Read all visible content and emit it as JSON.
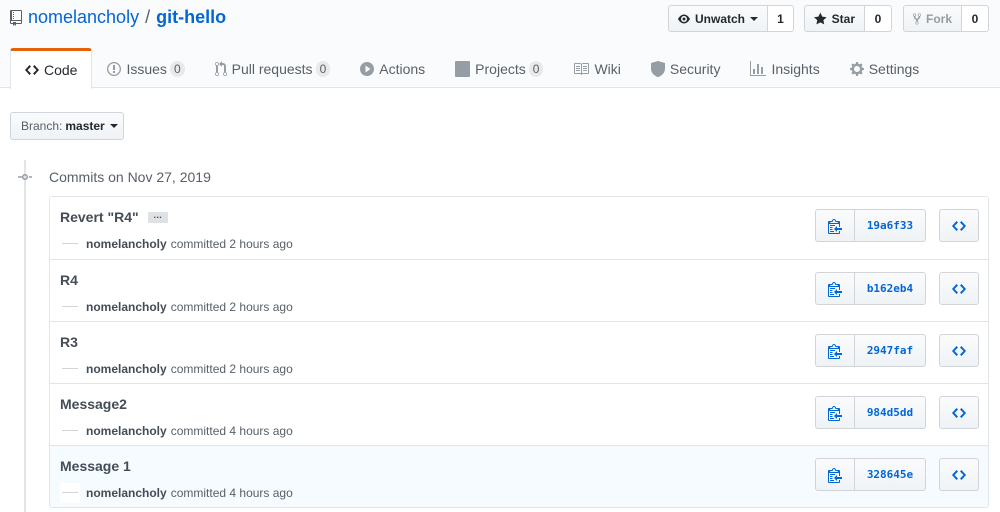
{
  "repo": {
    "owner": "nomelancholy",
    "separator": "/",
    "name": "git-hello"
  },
  "header_actions": [
    {
      "label": "Unwatch",
      "count": "1",
      "icon": "eye-icon"
    },
    {
      "label": "Star",
      "count": "0",
      "icon": "star-icon"
    },
    {
      "label": "Fork",
      "count": "0",
      "icon": "fork-icon"
    }
  ],
  "tabs": [
    {
      "label": "Code",
      "icon": "code-icon",
      "selected": true
    },
    {
      "label": "Issues",
      "counter": "0",
      "icon": "issue-icon"
    },
    {
      "label": "Pull requests",
      "counter": "0",
      "icon": "pull-request-icon"
    },
    {
      "label": "Actions",
      "icon": "play-icon"
    },
    {
      "label": "Projects",
      "counter": "0",
      "icon": "project-icon"
    },
    {
      "label": "Wiki",
      "icon": "book-icon"
    },
    {
      "label": "Security",
      "icon": "shield-icon"
    },
    {
      "label": "Insights",
      "icon": "graph-icon"
    },
    {
      "label": "Settings",
      "icon": "gear-icon"
    }
  ],
  "branch": {
    "label": "Branch:",
    "value": "master"
  },
  "commit_group": {
    "title": "Commits on Nov 27, 2019"
  },
  "commits": [
    {
      "title": "Revert \"R4\"",
      "has_ellipsis": true,
      "ellipsis": "…",
      "author": "nomelancholy",
      "verb": "committed",
      "time": "2 hours ago",
      "sha": "19a6f33"
    },
    {
      "title": "R4",
      "author": "nomelancholy",
      "verb": "committed",
      "time": "2 hours ago",
      "sha": "b162eb4"
    },
    {
      "title": "R3",
      "author": "nomelancholy",
      "verb": "committed",
      "time": "2 hours ago",
      "sha": "2947faf"
    },
    {
      "title": "Message2",
      "author": "nomelancholy",
      "verb": "committed",
      "time": "4 hours ago",
      "sha": "984d5dd"
    },
    {
      "title": "Message 1",
      "author": "nomelancholy",
      "verb": "committed",
      "time": "4 hours ago",
      "sha": "328645e",
      "highlighted": true
    }
  ],
  "colors": {
    "link": "#0366d6",
    "tab_accent": "#e36209",
    "border": "#e1e4e8",
    "muted": "#586069"
  }
}
